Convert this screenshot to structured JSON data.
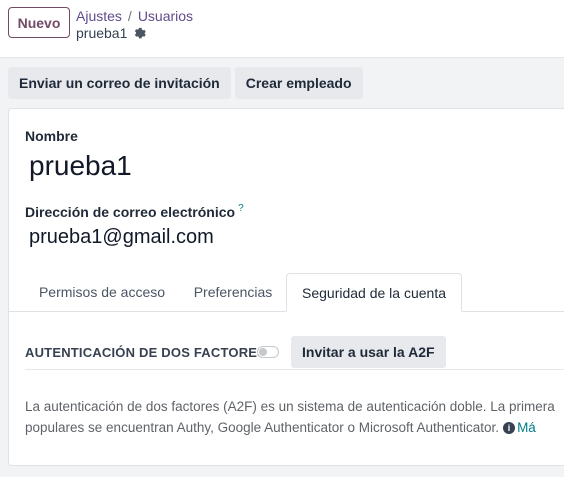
{
  "control_panel": {
    "new_button": "Nuevo",
    "breadcrumb": [
      "Ajustes",
      "Usuarios"
    ],
    "breadcrumb_separator": "/",
    "record_name": "prueba1"
  },
  "actions": {
    "invite_email": "Enviar un correo de invitación",
    "create_employee": "Crear empleado"
  },
  "form": {
    "name_label": "Nombre",
    "name_value": "prueba1",
    "email_label": "Dirección de correo electrónico",
    "email_help_marker": "?",
    "email_value": "prueba1@gmail.com"
  },
  "tabs": [
    {
      "label": "Permisos de acceso",
      "active": false
    },
    {
      "label": "Preferencias",
      "active": false
    },
    {
      "label": "Seguridad de la cuenta",
      "active": true
    }
  ],
  "security": {
    "twofa_title": "AUTENTICACIÓN DE DOS FACTORES",
    "twofa_enabled": false,
    "invite_button": "Invitar a usar la A2F",
    "description_line1": "La autenticación de dos factores (A2F) es un sistema de autenticación doble. La primera",
    "description_line2": "populares se encuentran Authy, Google Authenticator o Microsoft Authenticator.",
    "info_icon_glyph": "i",
    "more_link": "Má"
  },
  "colors": {
    "brand": "#714b67",
    "link": "#017e84",
    "button_bg": "#e7e9ed"
  },
  "icons": [
    "gear-icon",
    "info-icon",
    "toggle-switch"
  ]
}
